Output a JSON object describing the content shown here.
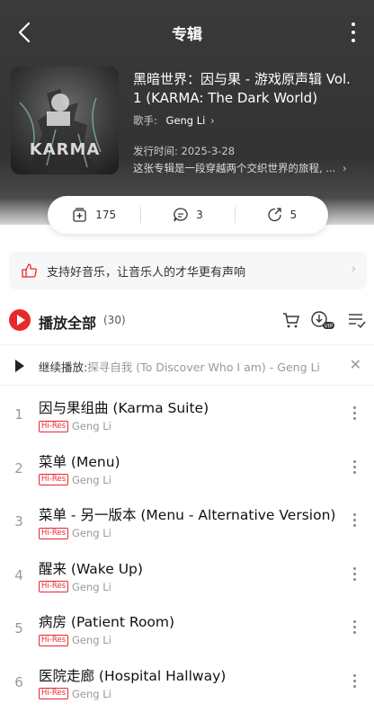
{
  "header": {
    "title": "专辑"
  },
  "album": {
    "title": "黑暗世界：因与果 - 游戏原声辑 Vol. 1 (KARMA: The Dark World)",
    "artist_label": "歌手:",
    "artist": "Geng Li",
    "release": "发行时间: 2025-3-28",
    "description": "这张专辑是一段穿越两个交织世界的旅程, ...",
    "cover_text": "KARMA"
  },
  "stats": {
    "collect": "175",
    "comments": "3",
    "shares": "5"
  },
  "support_text": "支持好音乐，让音乐人的才华更有声响",
  "playbar": {
    "label": "播放全部",
    "count": "(30)"
  },
  "resume": {
    "label": "继续播放:",
    "song": "探寻自我 (To Discover Who I am) - Geng Li"
  },
  "tracks": [
    {
      "num": "1",
      "title": "因与果组曲 (Karma Suite)",
      "badge": "Hi-Res",
      "artist": "Geng Li"
    },
    {
      "num": "2",
      "title": "菜单 (Menu)",
      "badge": "Hi-Res",
      "artist": "Geng Li"
    },
    {
      "num": "3",
      "title": "菜单 - 另一版本 (Menu - Alternative Version)",
      "badge": "Hi-Res",
      "artist": "Geng Li"
    },
    {
      "num": "4",
      "title": "醒来 (Wake Up)",
      "badge": "Hi-Res",
      "artist": "Geng Li"
    },
    {
      "num": "5",
      "title": "病房 (Patient Room)",
      "badge": "Hi-Res",
      "artist": "Geng Li"
    },
    {
      "num": "6",
      "title": "医院走廊 (Hospital Hallway)",
      "badge": "Hi-Res",
      "artist": "Geng Li"
    }
  ],
  "icons": [
    "back-icon",
    "more-icon",
    "collect-icon",
    "comment-icon",
    "share-icon",
    "thumb-up-icon",
    "cart-icon",
    "vip-download-icon",
    "multi-select-icon",
    "close-icon"
  ],
  "colors": {
    "accent": "#e8282b",
    "header_bg": "#333333"
  }
}
